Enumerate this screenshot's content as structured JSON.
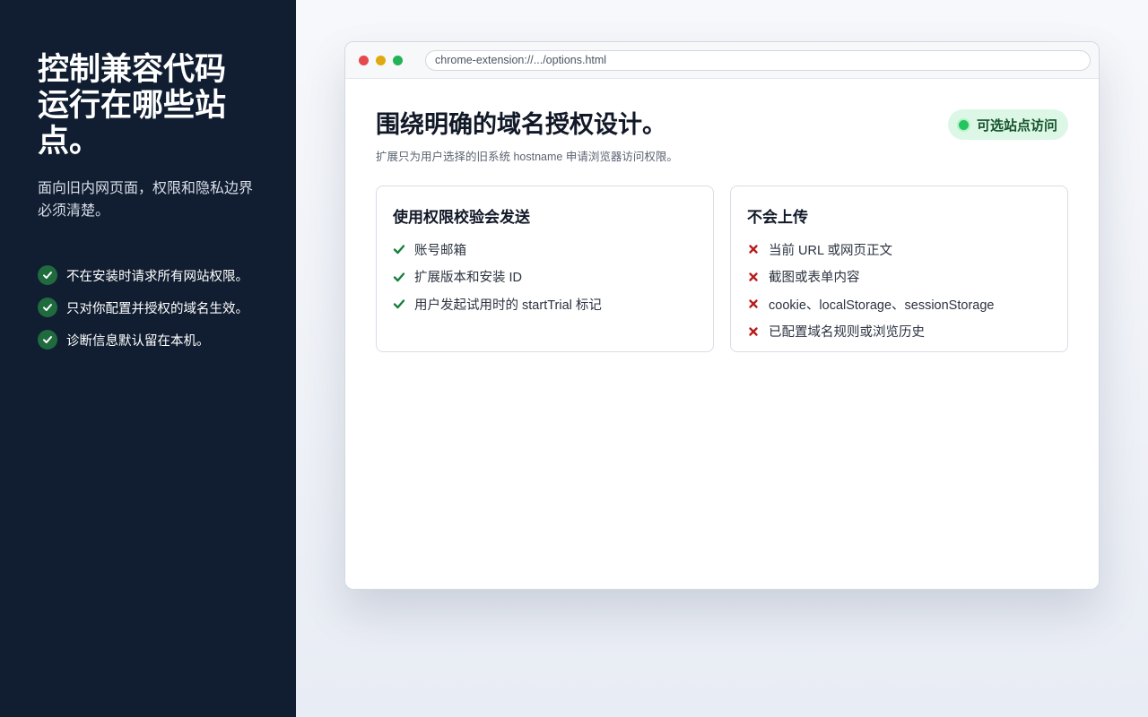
{
  "sidebar": {
    "title": "控制兼容代码运行在哪些站点。",
    "subtitle": "面向旧内网页面，权限和隐私边界必须清楚。",
    "features": [
      {
        "label": "不在安装时请求所有网站权限。",
        "icon": "check-icon"
      },
      {
        "label": "只对你配置并授权的域名生效。",
        "icon": "check-icon"
      },
      {
        "label": "诊断信息默认留在本机。",
        "icon": "check-icon"
      }
    ]
  },
  "browser": {
    "address": "chrome-extension://.../options.html",
    "window_controls": [
      "close",
      "minimize",
      "maximize"
    ]
  },
  "page": {
    "title": "围绕明确的域名授权设计。",
    "subtitle": "扩展只为用户选择的旧系统 hostname 申请浏览器访问权限。",
    "badge": "可选站点访问"
  },
  "cards": {
    "sent": {
      "title": "使用权限校验会发送",
      "items": [
        "账号邮箱",
        "扩展版本和安装 ID",
        "用户发起试用时的 startTrial 标记"
      ]
    },
    "not_uploaded": {
      "title": "不会上传",
      "items": [
        "当前 URL 或网页正文",
        "截图或表单内容",
        "cookie、localStorage、sessionStorage",
        "已配置域名规则或浏览历史"
      ]
    }
  },
  "colors": {
    "sidebar_bg": "#111e31",
    "check_green": "#1f6b3e",
    "badge_bg": "#dcf7e5",
    "x_red": "#b91c1c",
    "ok_green": "#15803d"
  }
}
